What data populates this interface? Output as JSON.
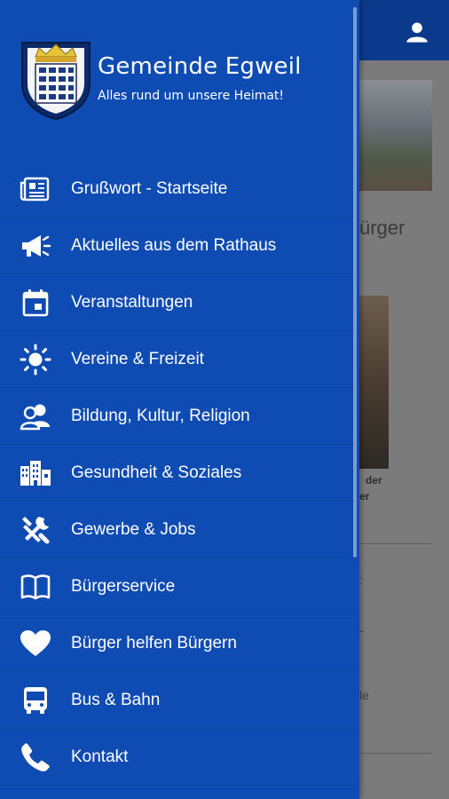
{
  "app": {
    "title": "Gemeinde Egweil",
    "subtitle": "Alles rund um unsere Heimat!"
  },
  "menu": {
    "items": [
      {
        "label": "Grußwort - Startseite",
        "icon": "newspaper-icon"
      },
      {
        "label": "Aktuelles aus dem Rathaus",
        "icon": "megaphone-icon"
      },
      {
        "label": "Veranstaltungen",
        "icon": "calendar-icon"
      },
      {
        "label": "Vereine & Freizeit",
        "icon": "sun-icon"
      },
      {
        "label": "Bildung, Kultur, Religion",
        "icon": "people-icon"
      },
      {
        "label": "Gesundheit & Soziales",
        "icon": "buildings-icon"
      },
      {
        "label": "Gewerbe & Jobs",
        "icon": "tools-icon"
      },
      {
        "label": "Bürgerservice",
        "icon": "book-icon"
      },
      {
        "label": "Bürger helfen Bürgern",
        "icon": "heart-icon"
      },
      {
        "label": "Bus & Bahn",
        "icon": "bus-icon"
      },
      {
        "label": "Kontakt",
        "icon": "phone-icon"
      }
    ]
  },
  "background": {
    "heading_fragment": "ürger",
    "caption_line1": "der",
    "caption_line2": "er",
    "frag1": ":",
    "frag2": "-",
    "frag3": "le"
  },
  "colors": {
    "drawer": "#0e4cb3",
    "topbar": "#0b3a8c",
    "overlay": "#7b7b7b"
  }
}
